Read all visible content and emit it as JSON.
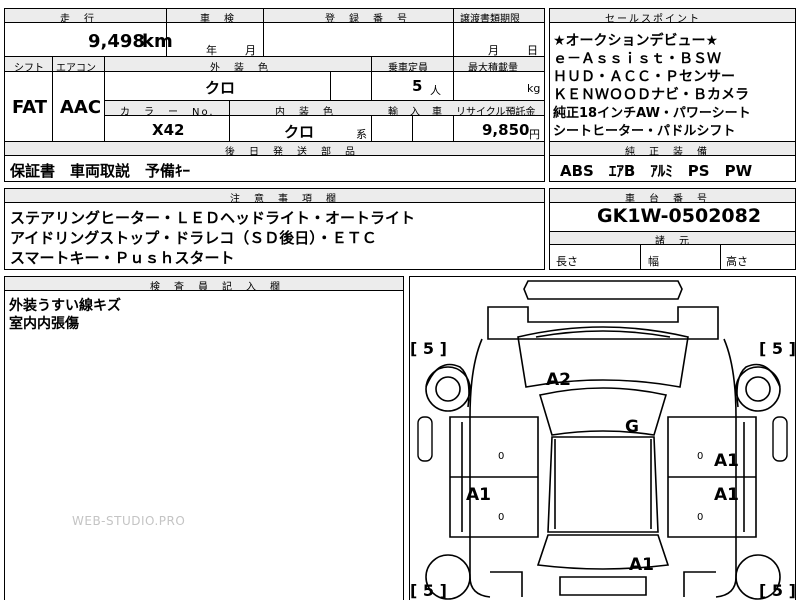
{
  "header_row": {
    "mileage_label": "走　行",
    "inspection_label": "車　検",
    "registration_label": "登　録　番　号",
    "transfer_label": "譲渡書類期限",
    "selling_points_label": "セールスポイント"
  },
  "mileage": {
    "value": "9,498",
    "unit": "km"
  },
  "inspection": {
    "year_unit": "年",
    "month_unit": "月"
  },
  "transfer": {
    "month_unit": "月",
    "day_unit": "日"
  },
  "row2_labels": {
    "shift": "シフト",
    "aircon": "エアコン",
    "exterior_color": "外　装　色",
    "capacity": "乗車定員",
    "max_load": "最大積載量"
  },
  "shift": "FAT",
  "aircon": "AAC",
  "exterior_color": "クロ",
  "capacity": {
    "value": "5",
    "unit": "人"
  },
  "max_load": {
    "value": "",
    "unit": "kg"
  },
  "row3_labels": {
    "color_no": "カ　ラ　ー　No.",
    "interior_color": "内　装　色",
    "import": "輸　入　車",
    "recycle": "リサイクル預託金"
  },
  "color_no": "X42",
  "interior_color": {
    "value": "クロ",
    "suffix": "系"
  },
  "recycle": {
    "value": "9,850",
    "unit": "円"
  },
  "later_parts": {
    "label": "後　日　発　送　部　品",
    "text": "保証書　車両取説　予備ｷｰ"
  },
  "selling_points": [
    "★オークションデビュー★",
    "ｅ－Ａｓｓｉｓｔ・ＢＳＷ",
    "ＨＵＤ・ＡＣＣ・Ｐセンサー",
    "ＫＥＮＷＯＯＤナビ・Ｂカメラ",
    "純正18インチAW・パワーシート",
    "シートヒーター・パドルシフト"
  ],
  "genuine_equipment": {
    "label": "純　正　装　備",
    "text": "ABS　ｴｱB　ｱﾙﾐ　PS　PW"
  },
  "notes": {
    "label": "注　意　事　項　欄",
    "lines": [
      "ステアリングヒーター・ＬＥＤヘッドライト・オートライト",
      "アイドリングストップ・ドラレコ（ＳＤ後日）・ＥＴＣ",
      "スマートキー・Ｐｕｓｈスタート"
    ]
  },
  "chassis": {
    "label": "車　台　番　号",
    "value": "GK1W-0502082"
  },
  "dimensions": {
    "label": "諸　元",
    "length": "長さ",
    "width": "幅",
    "height": "高さ"
  },
  "inspector": {
    "label": "検　査　員　記　入　欄",
    "lines": [
      "外装うすい線キズ",
      "室内内張傷"
    ]
  },
  "diagram": {
    "tire_marks": [
      "[ 5 ]",
      "[ 5 ]",
      "[ 5 ]",
      "[ 5 ]"
    ],
    "grades": [
      "A2",
      "G",
      "A1",
      "A1",
      "A1",
      "A1"
    ],
    "fuel_mark": "0"
  },
  "watermark": "WEB-STUDIO.PRO"
}
